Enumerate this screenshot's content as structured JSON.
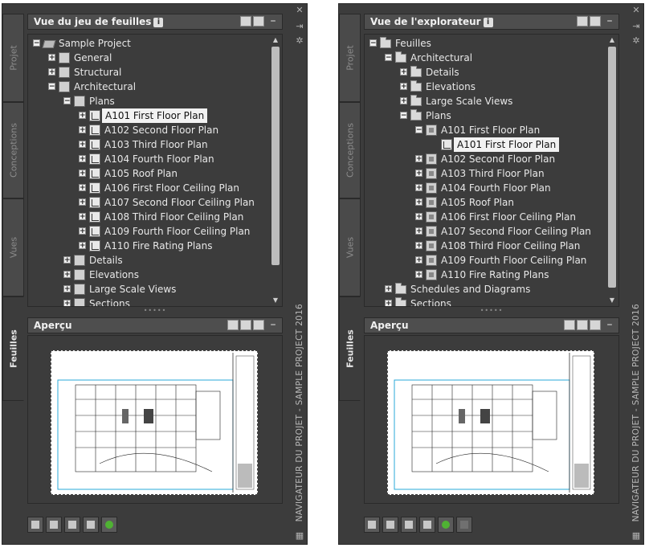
{
  "left_palette": {
    "tabs": [
      "Projet",
      "Conceptions",
      "Vues",
      "Feuilles"
    ],
    "active_tab": "Feuilles",
    "panel_title": "Vue du jeu de feuilles",
    "palette_title": "NAVIGATEUR DU PROJET - SAMPLE PROJECT 2016",
    "preview_title": "Aperçu",
    "tree": [
      {
        "label": "Sample Project",
        "level": 0,
        "toggle": "-",
        "icon": "project"
      },
      {
        "label": "General",
        "level": 1,
        "toggle": "+",
        "icon": "set"
      },
      {
        "label": "Structural",
        "level": 1,
        "toggle": "+",
        "icon": "set"
      },
      {
        "label": "Architectural",
        "level": 1,
        "toggle": "-",
        "icon": "set"
      },
      {
        "label": "Plans",
        "level": 2,
        "toggle": "-",
        "icon": "set"
      },
      {
        "label": "A101 First Floor Plan",
        "level": 3,
        "toggle": "+",
        "icon": "sheet",
        "selected": true
      },
      {
        "label": "A102 Second Floor Plan",
        "level": 3,
        "toggle": "+",
        "icon": "sheet"
      },
      {
        "label": "A103 Third Floor Plan",
        "level": 3,
        "toggle": "+",
        "icon": "sheet"
      },
      {
        "label": "A104 Fourth Floor Plan",
        "level": 3,
        "toggle": "+",
        "icon": "sheet"
      },
      {
        "label": "A105 Roof Plan",
        "level": 3,
        "toggle": "+",
        "icon": "sheet"
      },
      {
        "label": "A106 First Floor Ceiling Plan",
        "level": 3,
        "toggle": "+",
        "icon": "sheet"
      },
      {
        "label": "A107 Second Floor Ceiling Plan",
        "level": 3,
        "toggle": "+",
        "icon": "sheet"
      },
      {
        "label": "A108 Third Floor Ceiling Plan",
        "level": 3,
        "toggle": "+",
        "icon": "sheet"
      },
      {
        "label": "A109 Fourth Floor Ceiling Plan",
        "level": 3,
        "toggle": "+",
        "icon": "sheet"
      },
      {
        "label": "A110 Fire Rating Plans",
        "level": 3,
        "toggle": "+",
        "icon": "sheet"
      },
      {
        "label": "Details",
        "level": 2,
        "toggle": "+",
        "icon": "set"
      },
      {
        "label": "Elevations",
        "level": 2,
        "toggle": "+",
        "icon": "set"
      },
      {
        "label": "Large Scale Views",
        "level": 2,
        "toggle": "+",
        "icon": "set"
      },
      {
        "label": "Sections",
        "level": 2,
        "toggle": "+",
        "icon": "set"
      }
    ]
  },
  "right_palette": {
    "tabs": [
      "Projet",
      "Conceptions",
      "Vues",
      "Feuilles"
    ],
    "active_tab": "Feuilles",
    "panel_title": "Vue de l'explorateur",
    "palette_title": "NAVIGATEUR DU PROJET - SAMPLE PROJECT 2016",
    "preview_title": "Aperçu",
    "tree": [
      {
        "label": "Feuilles",
        "level": 0,
        "toggle": "-",
        "icon": "folder"
      },
      {
        "label": "Architectural",
        "level": 1,
        "toggle": "-",
        "icon": "folder"
      },
      {
        "label": "Details",
        "level": 2,
        "toggle": "+",
        "icon": "folder"
      },
      {
        "label": "Elevations",
        "level": 2,
        "toggle": "+",
        "icon": "folder"
      },
      {
        "label": "Large Scale Views",
        "level": 2,
        "toggle": "+",
        "icon": "folder"
      },
      {
        "label": "Plans",
        "level": 2,
        "toggle": "-",
        "icon": "folder"
      },
      {
        "label": "A101 First Floor Plan",
        "level": 3,
        "toggle": "-",
        "icon": "view"
      },
      {
        "label": "A101 First Floor Plan",
        "level": 4,
        "toggle": "",
        "icon": "sheet",
        "selected": true
      },
      {
        "label": "A102 Second Floor Plan",
        "level": 3,
        "toggle": "+",
        "icon": "view"
      },
      {
        "label": "A103 Third Floor Plan",
        "level": 3,
        "toggle": "+",
        "icon": "view"
      },
      {
        "label": "A104 Fourth Floor Plan",
        "level": 3,
        "toggle": "+",
        "icon": "view"
      },
      {
        "label": "A105 Roof Plan",
        "level": 3,
        "toggle": "+",
        "icon": "view"
      },
      {
        "label": "A106 First Floor Ceiling Plan",
        "level": 3,
        "toggle": "+",
        "icon": "view"
      },
      {
        "label": "A107 Second Floor Ceiling Plan",
        "level": 3,
        "toggle": "+",
        "icon": "view"
      },
      {
        "label": "A108 Third Floor Ceiling Plan",
        "level": 3,
        "toggle": "+",
        "icon": "view"
      },
      {
        "label": "A109 Fourth Floor Ceiling Plan",
        "level": 3,
        "toggle": "+",
        "icon": "view"
      },
      {
        "label": "A110 Fire Rating Plans",
        "level": 3,
        "toggle": "+",
        "icon": "view"
      },
      {
        "label": "Schedules and Diagrams",
        "level": 1,
        "toggle": "+",
        "icon": "folder"
      },
      {
        "label": "Sections",
        "level": 1,
        "toggle": "+",
        "icon": "folder"
      }
    ]
  },
  "colors": {
    "panel": "#3c3c3c",
    "header": "#4e4e4e",
    "text": "#e8e8e8",
    "selected_bg": "#f2f2f2",
    "sync_green": "#4fb233"
  }
}
